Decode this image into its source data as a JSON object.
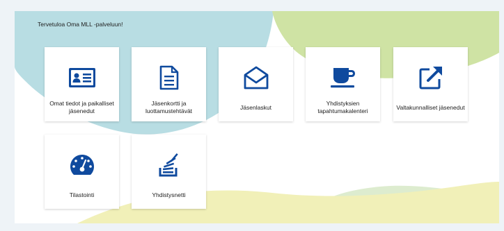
{
  "welcome_text": "Tervetuloa Oma MLL -palveluun!",
  "colors": {
    "brand_blue": "#0f4a9e",
    "bg_teal": "#b8dde3",
    "bg_green": "#cfe3a4",
    "bg_yellow": "#f1f0b8",
    "bg_mint": "#ddeccf"
  },
  "tiles": [
    {
      "label": "Omat tiedot ja paikalliset\njäsenedut",
      "icon": "id-card-icon"
    },
    {
      "label": "Jäsenkortti ja\nluottamustehtävät",
      "icon": "document-icon"
    },
    {
      "label": "Jäsenlaskut",
      "icon": "envelope-open-icon"
    },
    {
      "label": "Yhdistyksien\ntapahtumakalenteri",
      "icon": "coffee-cup-icon"
    },
    {
      "label": "Valtakunnalliset jäsenedut",
      "icon": "external-link-icon"
    },
    {
      "label": "Tilastointi",
      "icon": "dashboard-gauge-icon"
    },
    {
      "label": "Yhdistysnetti",
      "icon": "stack-icon"
    }
  ]
}
